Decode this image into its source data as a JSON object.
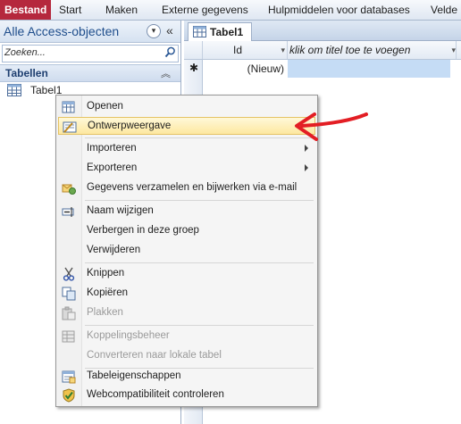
{
  "ribbon": {
    "tabs": [
      "Bestand",
      "Start",
      "Maken",
      "Externe gegevens",
      "Hulpmiddelen voor databases",
      "Velde"
    ]
  },
  "nav": {
    "title": "Alle Access-objecten",
    "search_placeholder": "Zoeken...",
    "group_label": "Tabellen",
    "items": [
      {
        "label": "Tabel1"
      }
    ]
  },
  "document": {
    "tab_label": "Tabel1",
    "columns": [
      "Id",
      "klik om titel toe te voegen"
    ],
    "new_row_marker": "✱",
    "new_row_value": "(Nieuw)"
  },
  "context_menu": {
    "items": [
      {
        "label": "Openen",
        "icon": "open-icon",
        "enabled": true
      },
      {
        "label": "Ontwerpweergave",
        "icon": "design-view-icon",
        "enabled": true,
        "highlighted": true
      },
      {
        "label": "Importeren",
        "submenu": true,
        "enabled": true
      },
      {
        "label": "Exporteren",
        "submenu": true,
        "enabled": true
      },
      {
        "label": "Gegevens verzamelen en bijwerken via e-mail",
        "icon": "collect-data-icon",
        "enabled": true
      },
      {
        "label": "Naam wijzigen",
        "icon": "rename-icon",
        "enabled": true
      },
      {
        "label": "Verbergen in deze groep",
        "enabled": true
      },
      {
        "label": "Verwijderen",
        "enabled": true
      },
      {
        "label": "Knippen",
        "icon": "scissors-icon",
        "enabled": true
      },
      {
        "label": "Kopiëren",
        "icon": "copy-icon",
        "enabled": true
      },
      {
        "label": "Plakken",
        "icon": "paste-icon",
        "enabled": false
      },
      {
        "label": "Koppelingsbeheer",
        "icon": "linked-table-manager-icon",
        "enabled": false
      },
      {
        "label": "Converteren naar lokale tabel",
        "enabled": false
      },
      {
        "label": "Tabeleigenschappen",
        "icon": "table-properties-icon",
        "enabled": true
      },
      {
        "label": "Webcompatibiliteit controleren",
        "icon": "web-compat-check-icon",
        "enabled": true
      }
    ]
  },
  "colors": {
    "file_tab": "#b5283d",
    "highlight": "#fde8a0",
    "annotation_arrow": "#e31e24",
    "new_cell": "#c5dcf5"
  }
}
